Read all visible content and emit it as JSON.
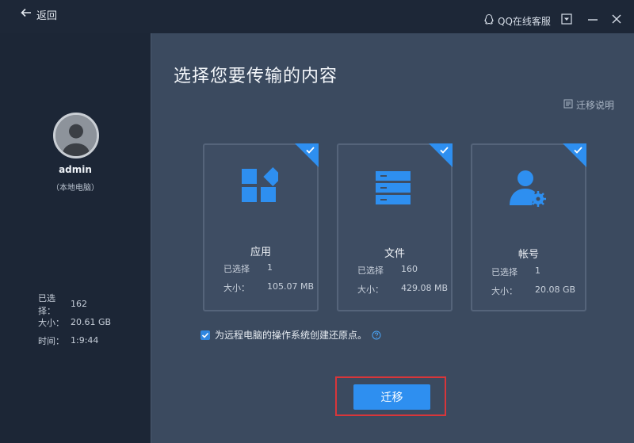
{
  "header": {
    "back_label": "返回",
    "support_label": "QQ在线客服"
  },
  "user": {
    "name": "admin",
    "subtitle": "（本地电脑）"
  },
  "summary": {
    "selected_label": "已选择：",
    "selected_value": "162",
    "size_label": "大小：",
    "size_value": "20.61 GB",
    "time_label": "时间：",
    "time_value": "1:9:44"
  },
  "main": {
    "title": "选择您要传输的内容",
    "guide_label": "迁移说明",
    "cards": [
      {
        "name": "应用",
        "selected_label": "已选择",
        "selected": "1",
        "size_label": "大小：",
        "size": "105.07 MB",
        "checked": true
      },
      {
        "name": "文件",
        "selected_label": "已选择",
        "selected": "160",
        "size_label": "大小：",
        "size": "429.08 MB",
        "checked": true
      },
      {
        "name": "帐号",
        "selected_label": "已选择",
        "selected": "1",
        "size_label": "大小：",
        "size": "20.08 GB",
        "checked": true
      }
    ],
    "restore_label": "为远程电脑的操作系统创建还原点。",
    "restore_checked": true,
    "migrate_label": "迁移"
  },
  "colors": {
    "accent": "#2e8ff0",
    "highlight_border": "#d8363a",
    "panel": "#3b4a5f",
    "sidebar": "#1c2636"
  },
  "icons": {
    "back": "arrow-left-icon",
    "support": "qq-penguin-icon",
    "guide": "document-icon",
    "app": "app-grid-icon",
    "file": "file-stack-icon",
    "account": "user-gear-icon",
    "check": "checkmark-icon",
    "help": "question-icon"
  }
}
